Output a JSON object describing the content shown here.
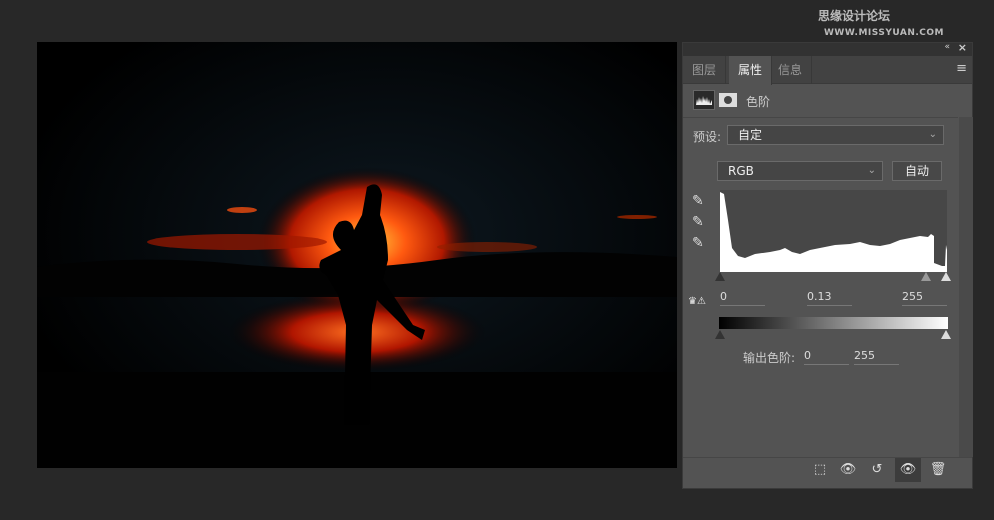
{
  "watermark": {
    "cn": "思缘设计论坛",
    "url": "WWW.MISSYUAN.COM"
  },
  "panel": {
    "tabs": [
      {
        "label": "图层"
      },
      {
        "label": "属性"
      },
      {
        "label": "信息"
      }
    ],
    "adjustment_title": "色阶",
    "preset_label": "预设:",
    "preset_value": "自定",
    "channel_value": "RGB",
    "auto_button": "自动",
    "input_levels": {
      "black": "0",
      "gamma": "0.13",
      "white": "255"
    },
    "output_label": "输出色阶:",
    "output_levels": {
      "black": "0",
      "white": "255"
    }
  },
  "colors": {
    "bg": "#282828",
    "panel": "#535353",
    "accent_sun": "#ff5a10"
  }
}
